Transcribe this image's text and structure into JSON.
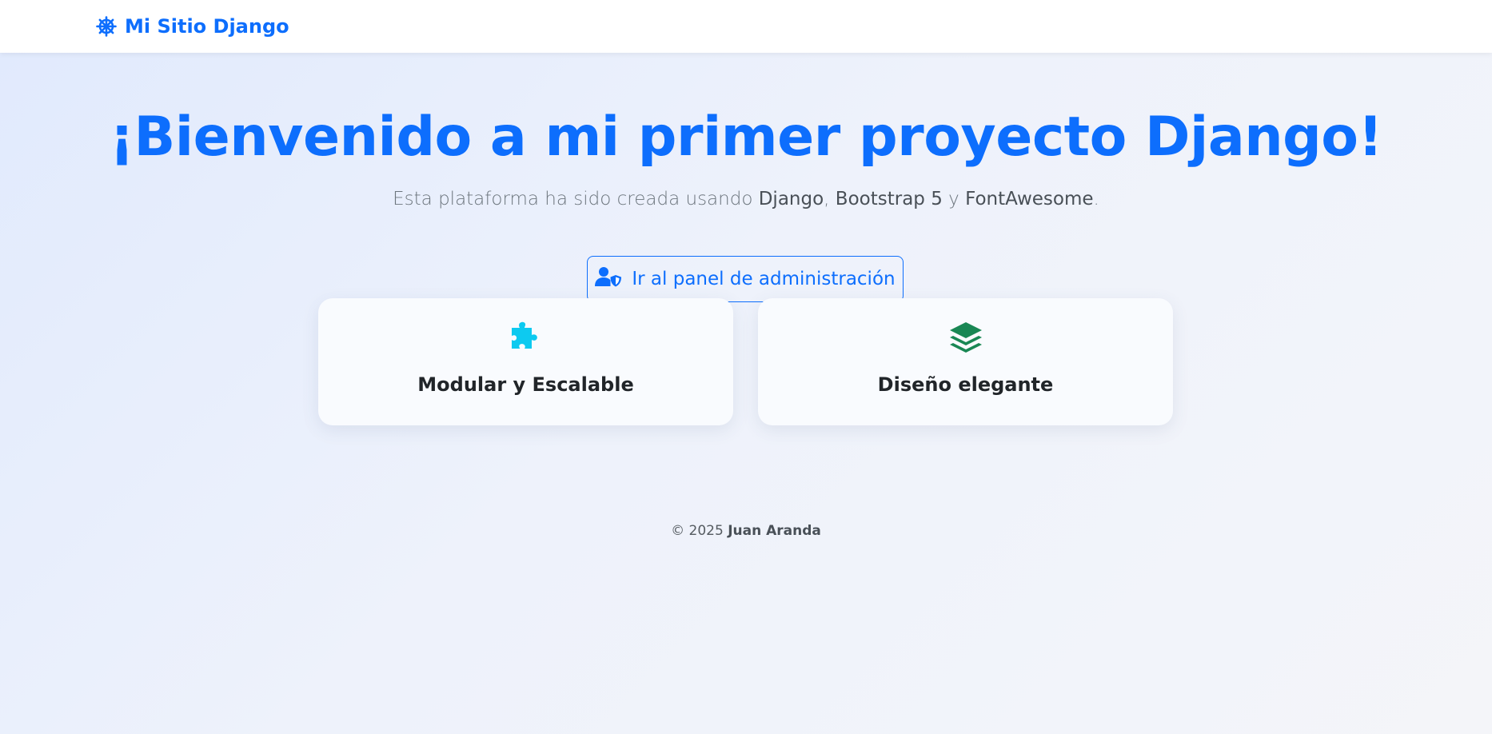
{
  "navbar": {
    "brand_icon": "helm-wheel-icon",
    "brand_text": "Mi Sitio Django",
    "brand_color": "#0d6efd"
  },
  "hero": {
    "title": "¡Bienvenido a mi primer proyecto Django!",
    "subtitle_prefix": "Esta plataforma ha sido creada usando ",
    "subtitle_tech1": "Django",
    "subtitle_sep1": ", ",
    "subtitle_tech2": "Bootstrap 5",
    "subtitle_sep2": " y ",
    "subtitle_tech3": "FontAwesome",
    "subtitle_suffix": ".",
    "admin_button": {
      "icon": "user-shield-icon",
      "label": "Ir al panel de administración"
    }
  },
  "features": [
    {
      "icon": "puzzle-piece-icon",
      "icon_color": "#0dcaf0",
      "title": "Modular y Escalable"
    },
    {
      "icon": "layer-group-icon",
      "icon_color": "#198754",
      "title": "Diseño elegante"
    }
  ],
  "footer": {
    "copyright": "© 2025 ",
    "author": "Juan Aranda"
  }
}
